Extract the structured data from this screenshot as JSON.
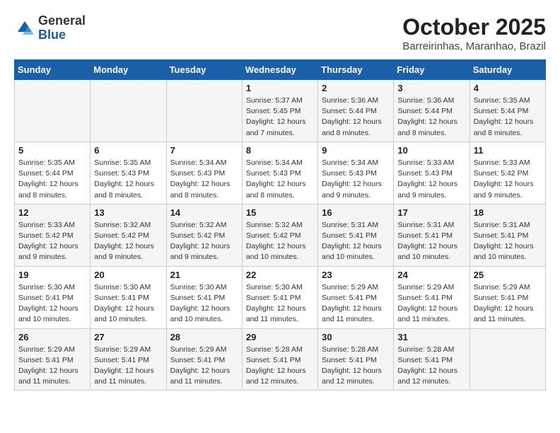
{
  "logo": {
    "general": "General",
    "blue": "Blue"
  },
  "title": "October 2025",
  "subtitle": "Barreirinhas, Maranhao, Brazil",
  "days": [
    "Sunday",
    "Monday",
    "Tuesday",
    "Wednesday",
    "Thursday",
    "Friday",
    "Saturday"
  ],
  "weeks": [
    [
      {
        "num": "",
        "info": ""
      },
      {
        "num": "",
        "info": ""
      },
      {
        "num": "",
        "info": ""
      },
      {
        "num": "1",
        "info": "Sunrise: 5:37 AM\nSunset: 5:45 PM\nDaylight: 12 hours\nand 7 minutes."
      },
      {
        "num": "2",
        "info": "Sunrise: 5:36 AM\nSunset: 5:44 PM\nDaylight: 12 hours\nand 8 minutes."
      },
      {
        "num": "3",
        "info": "Sunrise: 5:36 AM\nSunset: 5:44 PM\nDaylight: 12 hours\nand 8 minutes."
      },
      {
        "num": "4",
        "info": "Sunrise: 5:35 AM\nSunset: 5:44 PM\nDaylight: 12 hours\nand 8 minutes."
      }
    ],
    [
      {
        "num": "5",
        "info": "Sunrise: 5:35 AM\nSunset: 5:44 PM\nDaylight: 12 hours\nand 8 minutes."
      },
      {
        "num": "6",
        "info": "Sunrise: 5:35 AM\nSunset: 5:43 PM\nDaylight: 12 hours\nand 8 minutes."
      },
      {
        "num": "7",
        "info": "Sunrise: 5:34 AM\nSunset: 5:43 PM\nDaylight: 12 hours\nand 8 minutes."
      },
      {
        "num": "8",
        "info": "Sunrise: 5:34 AM\nSunset: 5:43 PM\nDaylight: 12 hours\nand 8 minutes."
      },
      {
        "num": "9",
        "info": "Sunrise: 5:34 AM\nSunset: 5:43 PM\nDaylight: 12 hours\nand 9 minutes."
      },
      {
        "num": "10",
        "info": "Sunrise: 5:33 AM\nSunset: 5:43 PM\nDaylight: 12 hours\nand 9 minutes."
      },
      {
        "num": "11",
        "info": "Sunrise: 5:33 AM\nSunset: 5:42 PM\nDaylight: 12 hours\nand 9 minutes."
      }
    ],
    [
      {
        "num": "12",
        "info": "Sunrise: 5:33 AM\nSunset: 5:42 PM\nDaylight: 12 hours\nand 9 minutes."
      },
      {
        "num": "13",
        "info": "Sunrise: 5:32 AM\nSunset: 5:42 PM\nDaylight: 12 hours\nand 9 minutes."
      },
      {
        "num": "14",
        "info": "Sunrise: 5:32 AM\nSunset: 5:42 PM\nDaylight: 12 hours\nand 9 minutes."
      },
      {
        "num": "15",
        "info": "Sunrise: 5:32 AM\nSunset: 5:42 PM\nDaylight: 12 hours\nand 10 minutes."
      },
      {
        "num": "16",
        "info": "Sunrise: 5:31 AM\nSunset: 5:41 PM\nDaylight: 12 hours\nand 10 minutes."
      },
      {
        "num": "17",
        "info": "Sunrise: 5:31 AM\nSunset: 5:41 PM\nDaylight: 12 hours\nand 10 minutes."
      },
      {
        "num": "18",
        "info": "Sunrise: 5:31 AM\nSunset: 5:41 PM\nDaylight: 12 hours\nand 10 minutes."
      }
    ],
    [
      {
        "num": "19",
        "info": "Sunrise: 5:30 AM\nSunset: 5:41 PM\nDaylight: 12 hours\nand 10 minutes."
      },
      {
        "num": "20",
        "info": "Sunrise: 5:30 AM\nSunset: 5:41 PM\nDaylight: 12 hours\nand 10 minutes."
      },
      {
        "num": "21",
        "info": "Sunrise: 5:30 AM\nSunset: 5:41 PM\nDaylight: 12 hours\nand 10 minutes."
      },
      {
        "num": "22",
        "info": "Sunrise: 5:30 AM\nSunset: 5:41 PM\nDaylight: 12 hours\nand 11 minutes."
      },
      {
        "num": "23",
        "info": "Sunrise: 5:29 AM\nSunset: 5:41 PM\nDaylight: 12 hours\nand 11 minutes."
      },
      {
        "num": "24",
        "info": "Sunrise: 5:29 AM\nSunset: 5:41 PM\nDaylight: 12 hours\nand 11 minutes."
      },
      {
        "num": "25",
        "info": "Sunrise: 5:29 AM\nSunset: 5:41 PM\nDaylight: 12 hours\nand 11 minutes."
      }
    ],
    [
      {
        "num": "26",
        "info": "Sunrise: 5:29 AM\nSunset: 5:41 PM\nDaylight: 12 hours\nand 11 minutes."
      },
      {
        "num": "27",
        "info": "Sunrise: 5:29 AM\nSunset: 5:41 PM\nDaylight: 12 hours\nand 11 minutes."
      },
      {
        "num": "28",
        "info": "Sunrise: 5:29 AM\nSunset: 5:41 PM\nDaylight: 12 hours\nand 11 minutes."
      },
      {
        "num": "29",
        "info": "Sunrise: 5:28 AM\nSunset: 5:41 PM\nDaylight: 12 hours\nand 12 minutes."
      },
      {
        "num": "30",
        "info": "Sunrise: 5:28 AM\nSunset: 5:41 PM\nDaylight: 12 hours\nand 12 minutes."
      },
      {
        "num": "31",
        "info": "Sunrise: 5:28 AM\nSunset: 5:41 PM\nDaylight: 12 hours\nand 12 minutes."
      },
      {
        "num": "",
        "info": ""
      }
    ]
  ]
}
